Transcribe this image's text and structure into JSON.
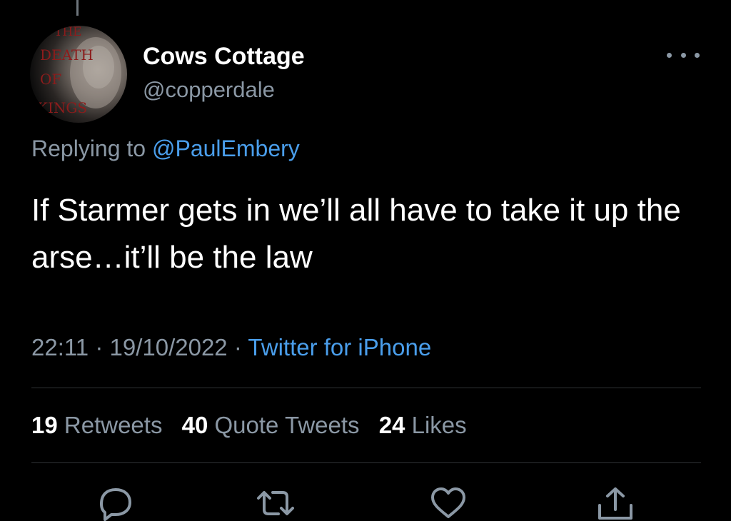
{
  "author": {
    "name": "Cows Cottage",
    "handle": "@copperdale",
    "avatar_text": [
      "THE",
      "DEATH",
      "OF",
      "KINGS"
    ]
  },
  "reply": {
    "prefix": "Replying to",
    "target": "@PaulEmbery"
  },
  "tweet": {
    "text": "If Starmer gets in we’ll all have to take it up the arse…it’ll be the law"
  },
  "meta": {
    "time": "22:11",
    "separator": "·",
    "date": "19/10/2022",
    "source": "Twitter for iPhone"
  },
  "stats": {
    "retweets_count": "19",
    "retweets_label": "Retweets",
    "quotes_count": "40",
    "quotes_label": "Quote Tweets",
    "likes_count": "24",
    "likes_label": "Likes"
  },
  "actions": [
    "reply-icon",
    "retweet-icon",
    "like-icon",
    "share-icon"
  ],
  "colors": {
    "background": "#000000",
    "text_primary": "#ffffff",
    "text_secondary": "#8b98a5",
    "link": "#4a9eeb",
    "divider": "#2f3336"
  }
}
